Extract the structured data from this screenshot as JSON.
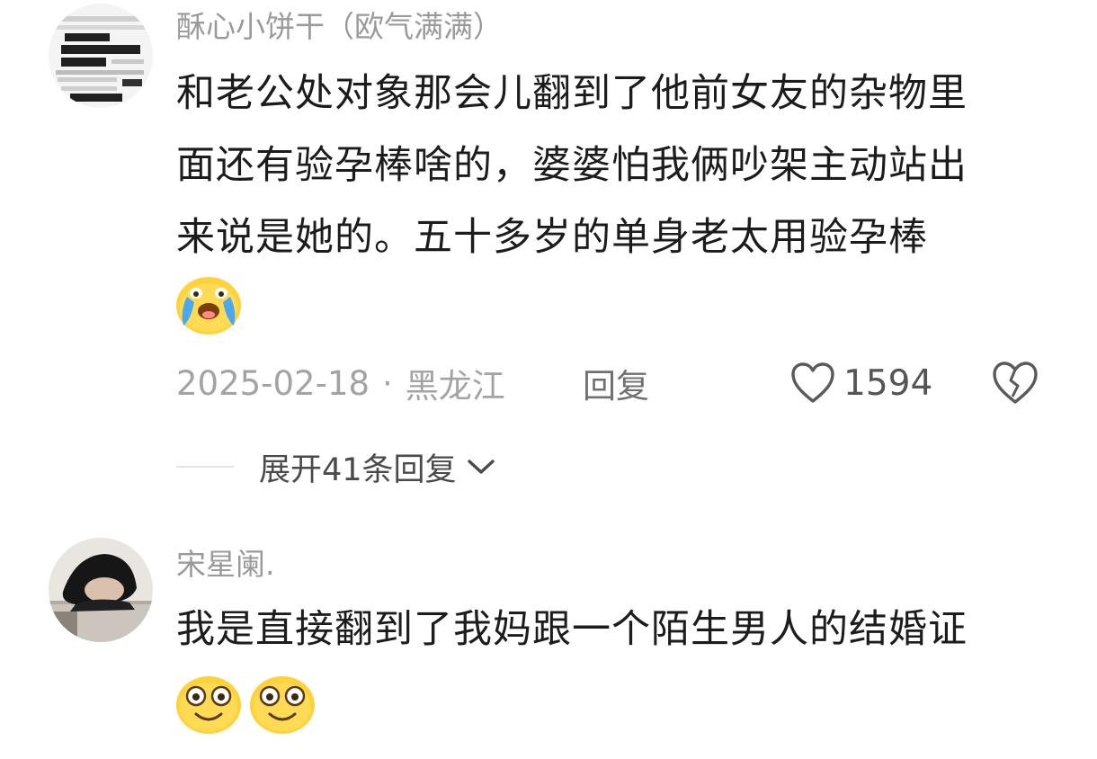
{
  "comments": [
    {
      "username": "酥心小饼干（欧气满满）",
      "avatar_icon": "text-collage-avatar",
      "text_lines": [
        "和老公处对象那会儿翻到了他前女友的杂物里",
        "面还有验孕棒啥的，婆婆怕我俩吵架主动站出",
        "来说是她的。五十多岁的单身老太用验孕棒"
      ],
      "emojis": [
        "crying-laughing-emoji"
      ],
      "date": "2025-02-18",
      "separator": "·",
      "location": "黑龙江",
      "reply_label": "回复",
      "like_count": "1594",
      "like_icon": "heart-outline-icon",
      "dislike_icon": "broken-heart-icon",
      "expand_label": "展开41条回复"
    },
    {
      "username": "宋星阑.",
      "avatar_icon": "photo-avatar",
      "text_lines": [
        "我是直接翻到了我妈跟一个陌生男人的结婚证"
      ],
      "emojis": [
        "wide-eyes-smile-emoji",
        "wide-eyes-smile-emoji"
      ]
    }
  ],
  "colors": {
    "username": "#9a9a9a",
    "body_text": "#1c1c1c",
    "meta": "#a3a3a3",
    "emoji_yellow": "#ffd23c"
  }
}
